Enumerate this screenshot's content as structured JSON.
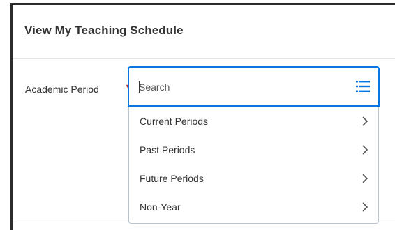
{
  "page": {
    "title": "View My Teaching Schedule"
  },
  "field": {
    "label": "Academic Period",
    "required_marker": "*",
    "placeholder": "Search",
    "value": ""
  },
  "dropdown": {
    "items": [
      {
        "label": "Current Periods"
      },
      {
        "label": "Past Periods"
      },
      {
        "label": "Future Periods"
      },
      {
        "label": "Non-Year"
      }
    ]
  },
  "icons": {
    "prompt": "list-icon",
    "item_expand": "chevron-right-icon"
  },
  "colors": {
    "accent": "#0875e1",
    "required": "#de2c2c",
    "text": "#333333"
  }
}
